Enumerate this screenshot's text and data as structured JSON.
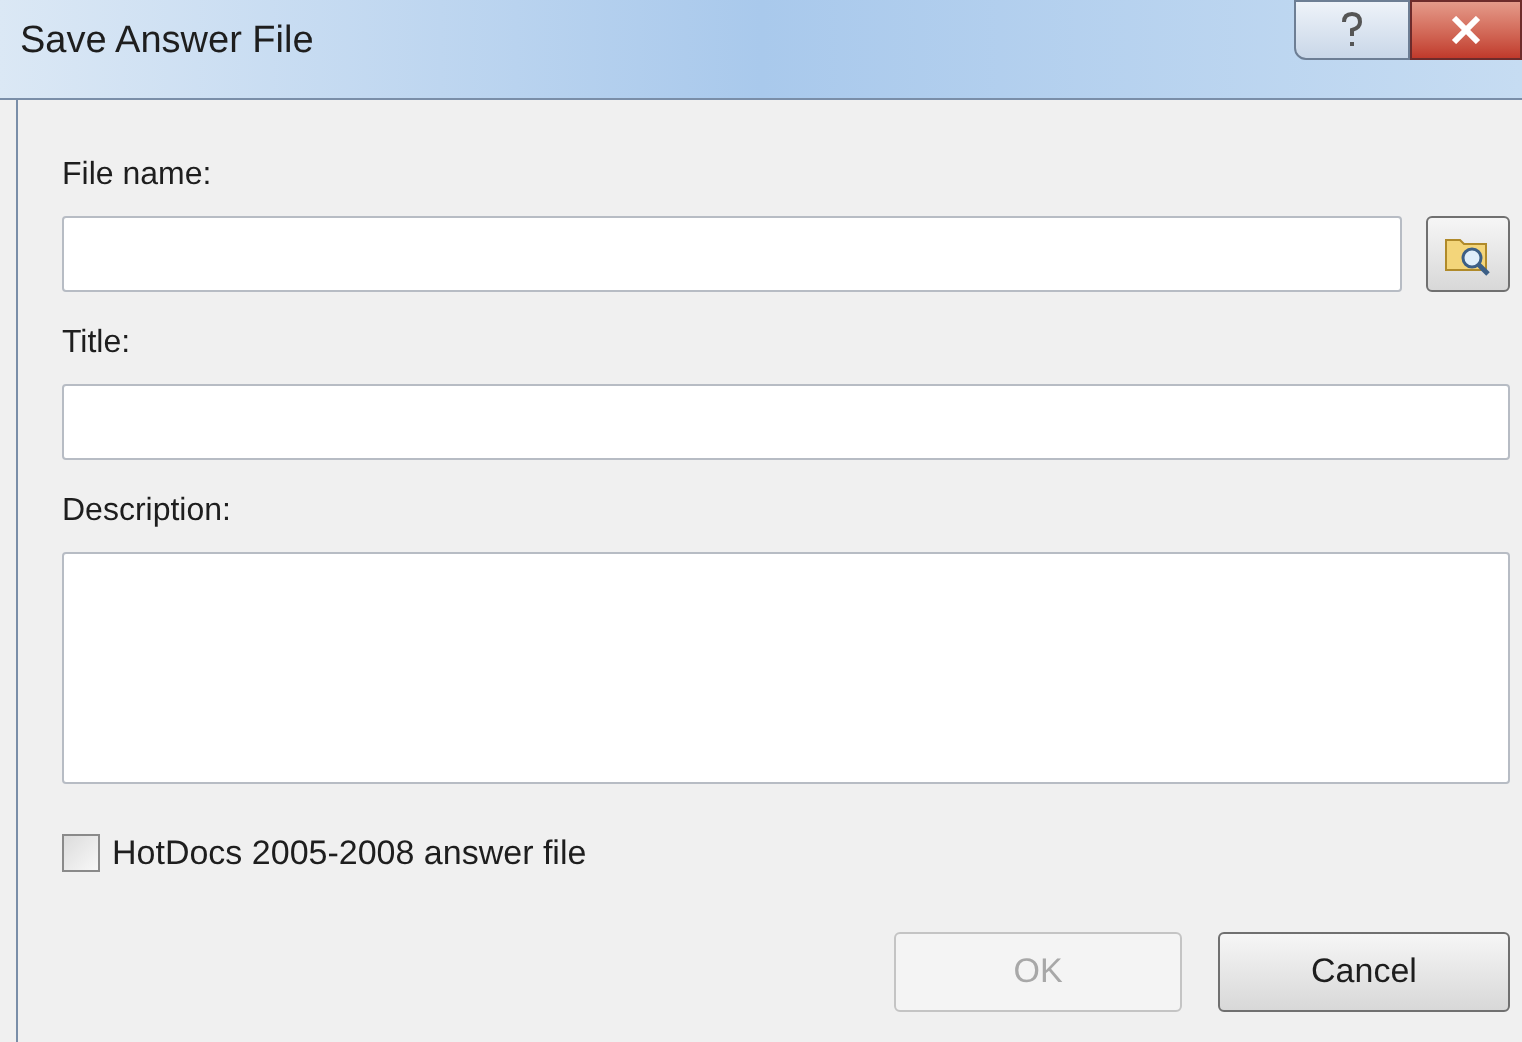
{
  "window": {
    "title": "Save Answer File"
  },
  "fields": [
    {
      "label": "File name:",
      "kind": "input",
      "browse": true
    },
    {
      "label": "Title:",
      "kind": "input",
      "browse": false
    },
    {
      "label": "Description:",
      "kind": "textarea",
      "browse": false
    }
  ],
  "checkbox": {
    "label": "HotDocs 2005-2008 answer file",
    "checked": false
  },
  "buttons": [
    {
      "label": "OK",
      "disabled": true
    },
    {
      "label": "Cancel",
      "disabled": false
    }
  ]
}
